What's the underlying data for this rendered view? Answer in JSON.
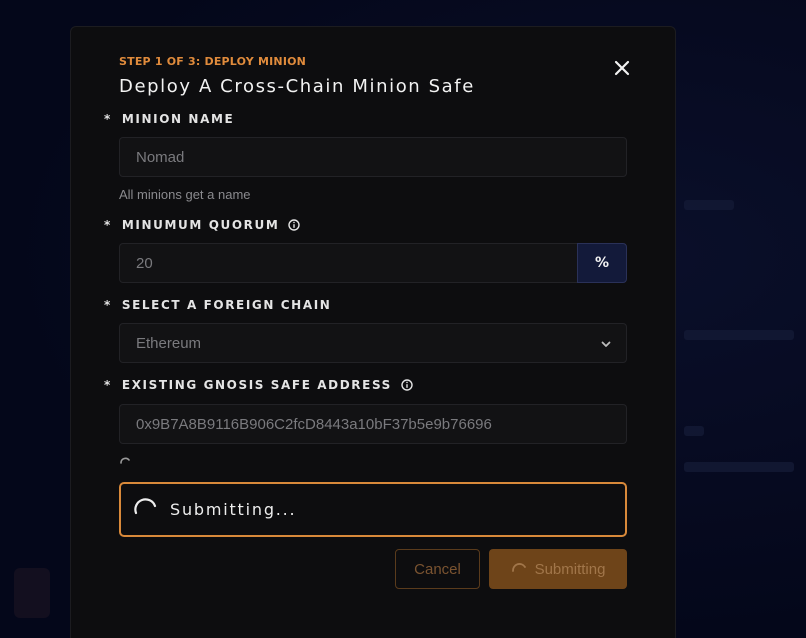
{
  "modal": {
    "step": "STEP 1 OF 3: DEPLOY MINION",
    "title": "Deploy A Cross-Chain Minion Safe",
    "close_icon": "close-icon"
  },
  "form": {
    "required_marker": "*",
    "minion_name": {
      "label": "MINION NAME",
      "value": "Nomad",
      "helper": "All minions get a name"
    },
    "quorum": {
      "label": "MINUMUM QUORUM",
      "value": "20",
      "addon": "%",
      "info_icon": "info-icon"
    },
    "chain": {
      "label": "SELECT A FOREIGN CHAIN",
      "value": "Ethereum",
      "chevron_icon": "chevron-down-icon"
    },
    "safe_address": {
      "label": "EXISTING GNOSIS SAFE ADDRESS",
      "value": "0x9B7A8B9116B906C2fcD8443a10bF37b5e9b76696",
      "info_icon": "info-icon"
    }
  },
  "status": {
    "text": "Submitting...",
    "icon": "spinner-icon"
  },
  "buttons": {
    "cancel": "Cancel",
    "submit": "Submitting"
  },
  "colors": {
    "accent": "#e08b3c",
    "modal_bg": "#0d0d0f",
    "page_bg": "#05081a",
    "addon_bg": "#131a3a"
  }
}
